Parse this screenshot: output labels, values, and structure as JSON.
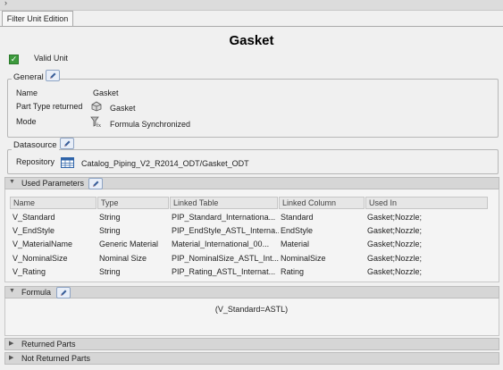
{
  "window": {
    "tab_label": "Filter Unit Edition",
    "collapse_glyph": "›"
  },
  "header": {
    "title": "Gasket"
  },
  "valid_unit": {
    "label": "Valid Unit",
    "checked": true,
    "check_glyph": "✓"
  },
  "general": {
    "legend": "General",
    "fields": [
      {
        "label": "Name",
        "value": "Gasket",
        "icon": null
      },
      {
        "label": "Part Type returned",
        "value": "Gasket",
        "icon": "part-type-icon"
      },
      {
        "label": "Mode",
        "value": "Formula Synchronized",
        "icon": "formula-mode-icon"
      }
    ]
  },
  "datasource": {
    "legend": "Datasource",
    "repository_label": "Repository",
    "repository_value": "Catalog_Piping_V2_R2014_ODT/Gasket_ODT",
    "icon": "table-icon"
  },
  "used_parameters": {
    "title": "Used Parameters",
    "columns": [
      "Name",
      "Type",
      "Linked Table",
      "Linked Column",
      "Used In"
    ],
    "rows": [
      [
        "V_Standard",
        "String",
        "PIP_Standard_Internationa...",
        "Standard",
        "Gasket;Nozzle;"
      ],
      [
        "V_EndStyle",
        "String",
        "PIP_EndStyle_ASTL_Interna...",
        "EndStyle",
        "Gasket;Nozzle;"
      ],
      [
        "V_MaterialName",
        "Generic Material",
        "Material_International_00...",
        "Material",
        "Gasket;Nozzle;"
      ],
      [
        "V_NominalSize",
        "Nominal Size",
        "PIP_NominalSize_ASTL_Int...",
        "NominalSize",
        "Gasket;Nozzle;"
      ],
      [
        "V_Rating",
        "String",
        "PIP_Rating_ASTL_Internat...",
        "Rating",
        "Gasket;Nozzle;"
      ]
    ]
  },
  "formula": {
    "title": "Formula",
    "text": "(V_Standard=ASTL)"
  },
  "collapsed_panels": {
    "returned": "Returned Parts",
    "not_returned": "Not Returned Parts"
  },
  "colors": {
    "check_green": "#3d9a3d",
    "header_gray": "#d6d6d6"
  }
}
